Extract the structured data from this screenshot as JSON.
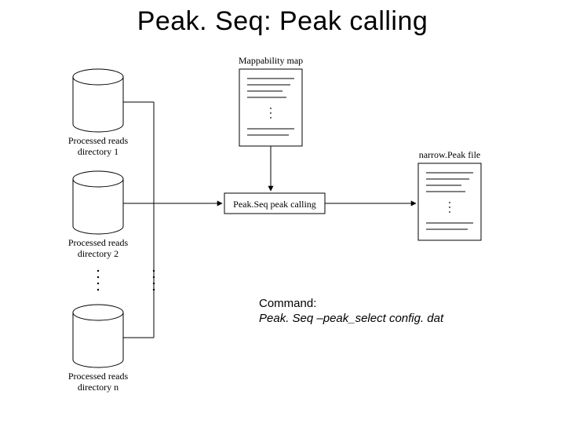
{
  "title": "Peak. Seq: Peak calling",
  "labels": {
    "mappability": "Mappability map",
    "dir1_a": "Processed reads",
    "dir1_b": "directory 1",
    "dir2_a": "Processed reads",
    "dir2_b": "directory 2",
    "dirn_a": "Processed reads",
    "dirn_b": "directory n",
    "center": "Peak.Seq peak calling",
    "output": "narrow.Peak file"
  },
  "command_heading": "Command:",
  "command_text": "Peak. Seq –peak_select config. dat"
}
